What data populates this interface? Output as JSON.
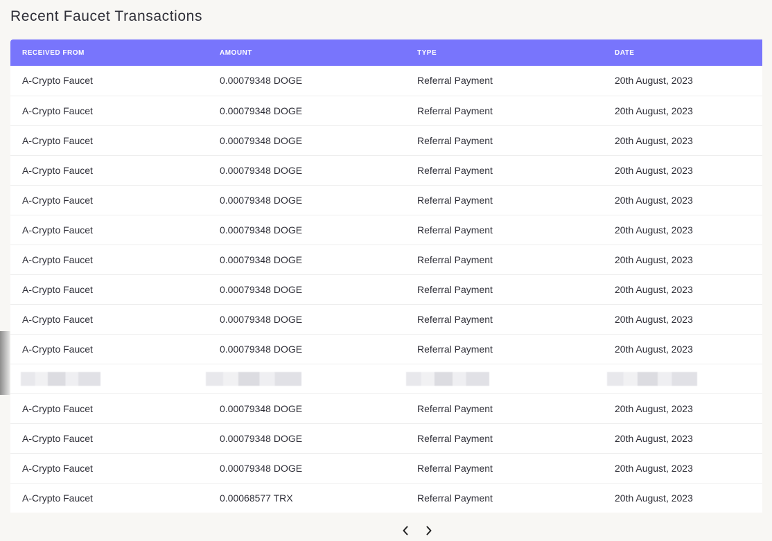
{
  "page": {
    "title": "Recent Faucet Transactions"
  },
  "table": {
    "columns": [
      "RECEIVED FROM",
      "AMOUNT",
      "TYPE",
      "DATE"
    ],
    "rows": [
      {
        "from": "A-Crypto Faucet",
        "amount": "0.00079348 DOGE",
        "type": "Referral Payment",
        "date": "20th August, 2023"
      },
      {
        "from": "A-Crypto Faucet",
        "amount": "0.00079348 DOGE",
        "type": "Referral Payment",
        "date": "20th August, 2023"
      },
      {
        "from": "A-Crypto Faucet",
        "amount": "0.00079348 DOGE",
        "type": "Referral Payment",
        "date": "20th August, 2023"
      },
      {
        "from": "A-Crypto Faucet",
        "amount": "0.00079348 DOGE",
        "type": "Referral Payment",
        "date": "20th August, 2023"
      },
      {
        "from": "A-Crypto Faucet",
        "amount": "0.00079348 DOGE",
        "type": "Referral Payment",
        "date": "20th August, 2023"
      },
      {
        "from": "A-Crypto Faucet",
        "amount": "0.00079348 DOGE",
        "type": "Referral Payment",
        "date": "20th August, 2023"
      },
      {
        "from": "A-Crypto Faucet",
        "amount": "0.00079348 DOGE",
        "type": "Referral Payment",
        "date": "20th August, 2023"
      },
      {
        "from": "A-Crypto Faucet",
        "amount": "0.00079348 DOGE",
        "type": "Referral Payment",
        "date": "20th August, 2023"
      },
      {
        "from": "A-Crypto Faucet",
        "amount": "0.00079348 DOGE",
        "type": "Referral Payment",
        "date": "20th August, 2023"
      },
      {
        "from": "A-Crypto Faucet",
        "amount": "0.00079348 DOGE",
        "type": "Referral Payment",
        "date": "20th August, 2023"
      },
      {
        "redacted": true
      },
      {
        "from": "A-Crypto Faucet",
        "amount": "0.00079348 DOGE",
        "type": "Referral Payment",
        "date": "20th August, 2023"
      },
      {
        "from": "A-Crypto Faucet",
        "amount": "0.00079348 DOGE",
        "type": "Referral Payment",
        "date": "20th August, 2023"
      },
      {
        "from": "A-Crypto Faucet",
        "amount": "0.00079348 DOGE",
        "type": "Referral Payment",
        "date": "20th August, 2023"
      },
      {
        "from": "A-Crypto Faucet",
        "amount": "0.00068577 TRX",
        "type": "Referral Payment",
        "date": "20th August, 2023"
      }
    ]
  },
  "pagination": {
    "prev_icon": "chevron-left-icon",
    "next_icon": "chevron-right-icon"
  },
  "colors": {
    "header_bg": "#7875fc",
    "page_bg": "#f8f7f4"
  }
}
